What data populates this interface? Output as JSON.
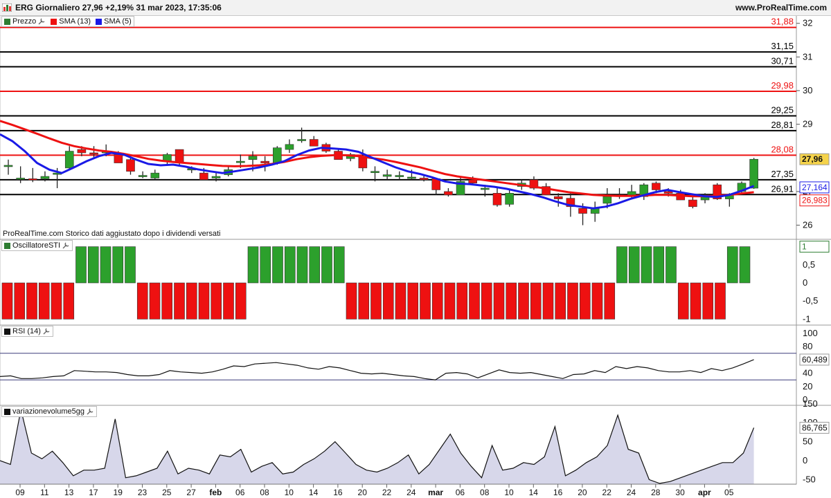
{
  "header": {
    "title": "ERG Giornaliero 27,96 +2,19% 31 mar 2023, 17:35:06",
    "site": "www.ProRealTime.com"
  },
  "legends": {
    "price": [
      {
        "label": "Prezzo",
        "color": "#2e7d32"
      },
      {
        "label": "SMA (13)",
        "color": "#ff0000"
      },
      {
        "label": "SMA (5)",
        "color": "#0000ee"
      }
    ],
    "sti": "OscillatoreSTI",
    "rsi": "RSI (14)",
    "volume": "variazionevolume5gg"
  },
  "caption": "ProRealTime.com Storico dati aggiustato dopo i dividendi versati",
  "colors": {
    "up": "#2ca02c",
    "down": "#ee1111",
    "sma13": "#ee1111",
    "sma5": "#1a1ae6",
    "black_line": "#000000",
    "red_line": "#ee1111"
  },
  "chart_data": [
    {
      "type": "candlestick",
      "name": "ERG price",
      "ylim": [
        25.6,
        32.2
      ],
      "y_ticks": [
        "32",
        "31",
        "30",
        "29",
        "27",
        "26"
      ],
      "x_tick_labels": [
        "09",
        "11",
        "13",
        "17",
        "19",
        "23",
        "25",
        "27",
        "feb",
        "06",
        "08",
        "10",
        "14",
        "16",
        "20",
        "22",
        "24",
        "mar",
        "06",
        "08",
        "10",
        "14",
        "16",
        "20",
        "22",
        "24",
        "28",
        "30",
        "apr",
        "05"
      ],
      "horizontal_levels": [
        {
          "value": 31.88,
          "label": "31,88",
          "color": "red"
        },
        {
          "value": 31.15,
          "label": "31,15",
          "color": "black"
        },
        {
          "value": 30.71,
          "label": "30,71",
          "color": "black"
        },
        {
          "value": 29.98,
          "label": "29,98",
          "color": "red"
        },
        {
          "value": 29.25,
          "label": "29,25",
          "color": "black"
        },
        {
          "value": 28.81,
          "label": "28,81",
          "color": "black"
        },
        {
          "value": 28.08,
          "label": "28,08",
          "color": "red"
        },
        {
          "value": 27.35,
          "label": "27,35",
          "color": "black"
        },
        {
          "value": 26.91,
          "label": "26,91",
          "color": "black"
        }
      ],
      "last_price_label": "27,96",
      "sma5_label": "27,164",
      "sma13_label": "26,983",
      "candles": [
        {
          "o": 27.78,
          "h": 27.95,
          "l": 27.5,
          "c": 27.78
        },
        {
          "o": 27.4,
          "h": 27.75,
          "l": 27.25,
          "c": 27.4
        },
        {
          "o": 27.38,
          "h": 27.7,
          "l": 27.28,
          "c": 27.35
        },
        {
          "o": 27.38,
          "h": 27.6,
          "l": 27.3,
          "c": 27.45
        },
        {
          "o": 27.55,
          "h": 27.7,
          "l": 27.1,
          "c": 27.55
        },
        {
          "o": 27.7,
          "h": 28.35,
          "l": 27.68,
          "c": 28.2
        },
        {
          "o": 28.25,
          "h": 28.35,
          "l": 28.05,
          "c": 28.15
        },
        {
          "o": 28.15,
          "h": 28.35,
          "l": 28.0,
          "c": 28.12
        },
        {
          "o": 28.15,
          "h": 28.4,
          "l": 28.05,
          "c": 28.2
        },
        {
          "o": 28.1,
          "h": 28.2,
          "l": 27.9,
          "c": 27.85
        },
        {
          "o": 27.95,
          "h": 28.1,
          "l": 27.5,
          "c": 27.6
        },
        {
          "o": 27.48,
          "h": 27.6,
          "l": 27.4,
          "c": 27.48
        },
        {
          "o": 27.4,
          "h": 27.65,
          "l": 27.35,
          "c": 27.55
        },
        {
          "o": 27.9,
          "h": 28.15,
          "l": 27.8,
          "c": 28.1
        },
        {
          "o": 28.25,
          "h": 28.25,
          "l": 27.75,
          "c": 27.85
        },
        {
          "o": 27.68,
          "h": 27.75,
          "l": 27.55,
          "c": 27.68
        },
        {
          "o": 27.55,
          "h": 27.7,
          "l": 27.35,
          "c": 27.35
        },
        {
          "o": 27.4,
          "h": 27.6,
          "l": 27.3,
          "c": 27.45
        },
        {
          "o": 27.5,
          "h": 27.75,
          "l": 27.45,
          "c": 27.65
        },
        {
          "o": 27.9,
          "h": 28.1,
          "l": 27.7,
          "c": 27.9
        },
        {
          "o": 27.95,
          "h": 28.2,
          "l": 27.6,
          "c": 28.05
        },
        {
          "o": 27.9,
          "h": 28.05,
          "l": 27.6,
          "c": 27.85
        },
        {
          "o": 27.85,
          "h": 28.35,
          "l": 27.8,
          "c": 28.3
        },
        {
          "o": 28.25,
          "h": 28.55,
          "l": 28.15,
          "c": 28.4
        },
        {
          "o": 28.55,
          "h": 28.9,
          "l": 28.45,
          "c": 28.55
        },
        {
          "o": 28.55,
          "h": 28.65,
          "l": 28.35,
          "c": 28.35
        },
        {
          "o": 28.4,
          "h": 28.45,
          "l": 28.15,
          "c": 28.2
        },
        {
          "o": 28.2,
          "h": 28.25,
          "l": 27.95,
          "c": 27.95
        },
        {
          "o": 27.98,
          "h": 28.15,
          "l": 27.9,
          "c": 28.1
        },
        {
          "o": 28.05,
          "h": 28.25,
          "l": 27.6,
          "c": 27.7
        },
        {
          "o": 27.6,
          "h": 27.75,
          "l": 27.3,
          "c": 27.6
        },
        {
          "o": 27.45,
          "h": 27.65,
          "l": 27.35,
          "c": 27.5
        },
        {
          "o": 27.45,
          "h": 27.6,
          "l": 27.35,
          "c": 27.48
        },
        {
          "o": 27.43,
          "h": 27.65,
          "l": 27.35,
          "c": 27.43
        },
        {
          "o": 27.4,
          "h": 27.5,
          "l": 27.3,
          "c": 27.35
        },
        {
          "o": 27.38,
          "h": 27.4,
          "l": 26.9,
          "c": 27.05
        },
        {
          "o": 27.0,
          "h": 27.1,
          "l": 26.85,
          "c": 26.9
        },
        {
          "o": 26.9,
          "h": 27.45,
          "l": 26.9,
          "c": 27.3
        },
        {
          "o": 27.35,
          "h": 27.45,
          "l": 27.2,
          "c": 27.25
        },
        {
          "o": 27.1,
          "h": 27.2,
          "l": 26.85,
          "c": 27.1
        },
        {
          "o": 26.95,
          "h": 27.15,
          "l": 26.55,
          "c": 26.6
        },
        {
          "o": 26.62,
          "h": 27.05,
          "l": 26.55,
          "c": 26.95
        },
        {
          "o": 27.15,
          "h": 27.35,
          "l": 27.05,
          "c": 27.25
        },
        {
          "o": 27.35,
          "h": 27.45,
          "l": 27.05,
          "c": 27.1
        },
        {
          "o": 27.15,
          "h": 27.25,
          "l": 26.95,
          "c": 26.9
        },
        {
          "o": 26.85,
          "h": 26.95,
          "l": 26.55,
          "c": 26.78
        },
        {
          "o": 26.8,
          "h": 26.95,
          "l": 26.25,
          "c": 26.55
        },
        {
          "o": 26.5,
          "h": 26.65,
          "l": 26.0,
          "c": 26.35
        },
        {
          "o": 26.35,
          "h": 26.7,
          "l": 26.1,
          "c": 26.5
        },
        {
          "o": 26.65,
          "h": 27.1,
          "l": 26.5,
          "c": 26.85
        },
        {
          "o": 26.85,
          "h": 27.1,
          "l": 26.78,
          "c": 26.9
        },
        {
          "o": 26.9,
          "h": 27.2,
          "l": 26.8,
          "c": 27.0
        },
        {
          "o": 26.85,
          "h": 27.25,
          "l": 26.75,
          "c": 27.2
        },
        {
          "o": 27.25,
          "h": 27.3,
          "l": 26.95,
          "c": 27.05
        },
        {
          "o": 27.0,
          "h": 27.1,
          "l": 26.85,
          "c": 26.95
        },
        {
          "o": 26.95,
          "h": 27.05,
          "l": 26.75,
          "c": 26.75
        },
        {
          "o": 26.75,
          "h": 26.85,
          "l": 26.5,
          "c": 26.55
        },
        {
          "o": 26.75,
          "h": 26.95,
          "l": 26.65,
          "c": 26.9
        },
        {
          "o": 27.2,
          "h": 27.25,
          "l": 26.75,
          "c": 26.78
        },
        {
          "o": 26.78,
          "h": 26.95,
          "l": 26.55,
          "c": 26.9
        },
        {
          "o": 27.0,
          "h": 27.3,
          "l": 26.95,
          "c": 27.25
        },
        {
          "o": 27.1,
          "h": 28.0,
          "l": 27.08,
          "c": 27.96
        }
      ],
      "sma13": [
        29.1,
        28.98,
        28.85,
        28.72,
        28.58,
        28.45,
        28.35,
        28.28,
        28.22,
        28.18,
        28.12,
        28.05,
        27.97,
        27.92,
        27.88,
        27.85,
        27.82,
        27.79,
        27.76,
        27.75,
        27.76,
        27.78,
        27.82,
        27.88,
        27.96,
        28.02,
        28.06,
        28.08,
        28.08,
        28.05,
        28.0,
        27.95,
        27.88,
        27.8,
        27.72,
        27.62,
        27.52,
        27.45,
        27.4,
        27.35,
        27.3,
        27.25,
        27.2,
        27.15,
        27.1,
        27.04,
        26.98,
        26.94,
        26.9,
        26.88,
        26.87,
        26.87,
        26.88,
        26.9,
        26.9,
        26.88,
        26.86,
        26.86,
        26.88,
        26.9,
        26.94,
        26.98
      ],
      "sma5": [
        28.7,
        28.5,
        28.2,
        27.85,
        27.65,
        27.55,
        27.72,
        27.9,
        28.05,
        28.15,
        28.1,
        27.95,
        27.82,
        27.78,
        27.8,
        27.74,
        27.66,
        27.6,
        27.55,
        27.6,
        27.66,
        27.72,
        27.8,
        27.9,
        28.08,
        28.22,
        28.3,
        28.28,
        28.25,
        28.18,
        28.02,
        27.87,
        27.72,
        27.6,
        27.52,
        27.42,
        27.3,
        27.24,
        27.22,
        27.18,
        27.14,
        27.08,
        27.0,
        26.92,
        26.82,
        26.7,
        26.6,
        26.55,
        26.5,
        26.55,
        26.65,
        26.78,
        26.88,
        26.98,
        27.05,
        26.98,
        26.92,
        26.86,
        26.84,
        26.9,
        27.02,
        27.164
      ]
    },
    {
      "type": "bar",
      "name": "OscillatoreSTI",
      "ylim": [
        -1.05,
        1.05
      ],
      "y_ticks": [
        "1",
        "0,5",
        "0",
        "-0,5",
        "-1"
      ],
      "current_label": "1",
      "values": [
        -1,
        -1,
        -1,
        -1,
        -1,
        -1,
        1,
        1,
        1,
        1,
        1,
        -1,
        -1,
        -1,
        -1,
        -1,
        -1,
        -1,
        -1,
        -1,
        1,
        1,
        1,
        1,
        1,
        1,
        1,
        1,
        -1,
        -1,
        -1,
        -1,
        -1,
        -1,
        -1,
        -1,
        -1,
        -1,
        -1,
        -1,
        -1,
        -1,
        -1,
        -1,
        -1,
        -1,
        -1,
        -1,
        -1,
        -1,
        1,
        1,
        1,
        1,
        1,
        -1,
        -1,
        -1,
        -1,
        1,
        1
      ]
    },
    {
      "type": "line",
      "name": "RSI (14)",
      "ylim": [
        0,
        100
      ],
      "y_ticks": [
        "100",
        "80",
        "60",
        "40",
        "20",
        "0"
      ],
      "bands": [
        70,
        30
      ],
      "current_label": "60,489",
      "values": [
        35,
        36,
        32,
        32,
        33,
        35,
        36,
        44,
        43,
        42,
        42,
        41,
        38,
        36,
        36,
        38,
        44,
        42,
        41,
        40,
        42,
        46,
        51,
        50,
        54,
        55,
        56,
        54,
        52,
        48,
        46,
        50,
        48,
        44,
        40,
        39,
        40,
        38,
        36,
        35,
        32,
        30,
        40,
        41,
        39,
        33,
        39,
        45,
        41,
        40,
        41,
        38,
        35,
        32,
        38,
        39,
        44,
        41,
        50,
        47,
        50,
        48,
        44,
        42,
        42,
        44,
        41,
        47,
        44,
        48,
        54,
        60.5
      ]
    },
    {
      "type": "area",
      "name": "variazionevolume5gg",
      "ylim": [
        -62,
        135
      ],
      "y_ticks": [
        "150",
        "100",
        "50",
        "0",
        "-50"
      ],
      "current_label": "86,765",
      "values": [
        0,
        -10,
        135,
        20,
        5,
        25,
        -5,
        -40,
        -25,
        -25,
        -20,
        110,
        -45,
        -40,
        -30,
        -20,
        25,
        -35,
        -20,
        -25,
        -35,
        15,
        10,
        30,
        -30,
        -15,
        -5,
        -35,
        -30,
        -10,
        5,
        25,
        50,
        20,
        -10,
        -25,
        -30,
        -20,
        -5,
        15,
        -35,
        -10,
        30,
        70,
        20,
        -15,
        -45,
        40,
        -25,
        -20,
        -5,
        -10,
        10,
        90,
        -40,
        -25,
        -5,
        10,
        40,
        120,
        30,
        20,
        -50,
        -60,
        -55,
        -45,
        -35,
        -25,
        -15,
        -5,
        -5,
        20,
        86.765
      ]
    }
  ]
}
